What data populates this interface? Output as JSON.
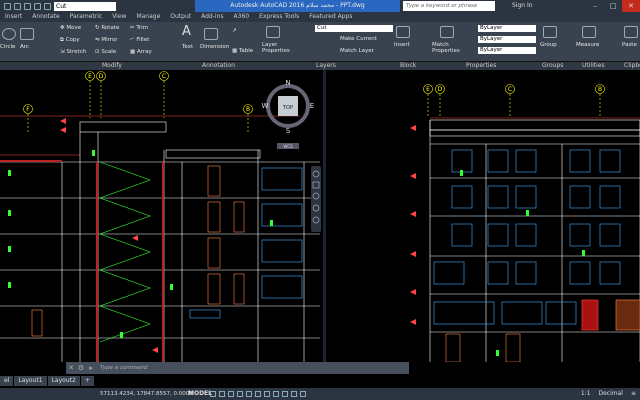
{
  "titlebar": {
    "layer_value": "Cut",
    "title": "Autodesk AutoCAD 2016   محمد سلام - PPT.dwg",
    "search_placeholder": "Type a keyword or phrase",
    "signin": "Sign In"
  },
  "tabs": [
    "Insert",
    "Annotate",
    "Parametric",
    "View",
    "Manage",
    "Output",
    "Add-ins",
    "A360",
    "Express Tools",
    "Featured Apps"
  ],
  "ribbon": {
    "circle": "Circle",
    "arc": "Arc",
    "move": "Move",
    "rotate": "Rotate",
    "trim": "Trim",
    "copy": "Copy",
    "mirror": "Mirror",
    "fillet": "Fillet",
    "stretch": "Stretch",
    "scale": "Scale",
    "array": "Array",
    "text": "Text",
    "dimension": "Dimension",
    "table": "Table",
    "layer_properties": "Layer Properties",
    "layer_combo": "Cut",
    "make_current": "Make Current",
    "match_layer": "Match Layer",
    "insert": "Insert",
    "match_properties": "Match Properties",
    "bylayer1": "ByLayer",
    "bylayer2": "ByLayer",
    "bylayer3": "ByLayer",
    "group": "Group",
    "measure": "Measure",
    "paste": "Paste"
  },
  "panels": {
    "modify": "Modify",
    "annotation": "Annotation",
    "layers": "Layers",
    "block": "Block",
    "properties": "Properties",
    "groups": "Groups",
    "utilities": "Utilities",
    "clipboard": "Clipbo"
  },
  "viewcube": {
    "top": "TOP",
    "n": "N",
    "s": "S",
    "e": "E",
    "w": "W",
    "wcs": "WCS"
  },
  "grid_left": [
    "F",
    "E",
    "D",
    "C",
    "B"
  ],
  "grid_right": [
    "E",
    "D",
    "C",
    "B"
  ],
  "command": {
    "prompt": "Type a command"
  },
  "layout_tabs": [
    "el",
    "Layout1",
    "Layout2"
  ],
  "status": {
    "coords": "57113.4234, 17847.8557, 0.0000",
    "model": "MODEL",
    "scale": "1:1",
    "units": "Decimal"
  },
  "colors": {
    "accent": "#2a67c0",
    "background": "#000000",
    "ribbon": "#39424f"
  }
}
